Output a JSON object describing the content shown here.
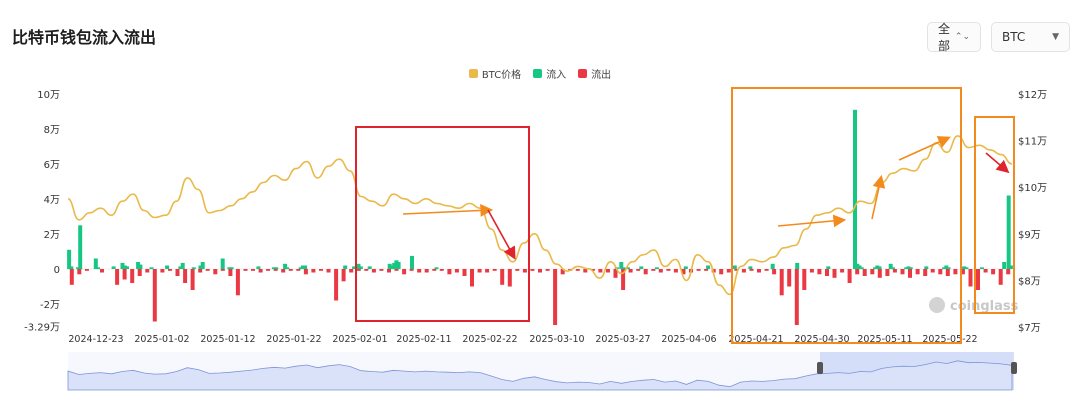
{
  "header": {
    "title": "比特币钱包流入流出",
    "range_select": "全部",
    "asset_select": "BTC"
  },
  "watermark": "coinglass",
  "colors": {
    "price": "#e9b949",
    "inflow": "#16c784",
    "outflow": "#ea3943",
    "box_red": "#e0242d",
    "box_orange": "#f38a1d",
    "arrow_orange": "#f38a1d",
    "arrow_red": "#e0242d",
    "navigator_fill": "#c8d3f5",
    "navigator_line": "#7d93d9"
  },
  "chart_data": {
    "type": "bar",
    "legend": [
      {
        "name": "BTC价格",
        "color": "#e9b949"
      },
      {
        "name": "流入",
        "color": "#16c784"
      },
      {
        "name": "流出",
        "color": "#ea3943"
      }
    ],
    "x_tick_labels": [
      "2024-12-23",
      "2025-01-02",
      "2025-01-12",
      "2025-01-22",
      "2025-02-01",
      "2025-02-11",
      "2025-02-22",
      "2025-03-10",
      "2025-03-27",
      "2025-04-06",
      "2025-04-21",
      "2025-04-30",
      "2025-05-11",
      "2025-05-22"
    ],
    "y_left_ticks": [
      "10万",
      "8万",
      "6万",
      "4万",
      "2万",
      "0",
      "-2万",
      "-3.29万"
    ],
    "y_left_values": [
      100000,
      80000,
      60000,
      40000,
      20000,
      0,
      -20000,
      -32900
    ],
    "y_right_ticks": [
      "$12万",
      "$11万",
      "$10万",
      "$9万",
      "$8万",
      "$7万"
    ],
    "y_right_values": [
      120000,
      110000,
      100000,
      90000,
      80000,
      70000
    ],
    "ylim_left": [
      -32900,
      100000
    ],
    "ylim_right": [
      70000,
      120000
    ],
    "series": [
      {
        "name": "流入",
        "type": "bar",
        "values": [
          11000,
          1500,
          0,
          0,
          1000,
          25000,
          0,
          0,
          0,
          0,
          0,
          0,
          6000,
          1000,
          0,
          0,
          0,
          0,
          0,
          0,
          1500,
          0,
          0,
          0,
          3500,
          2000,
          1500,
          0,
          0,
          0,
          0,
          4000,
          2500,
          0,
          0,
          0,
          0,
          1000,
          0,
          0,
          0,
          0,
          0,
          0,
          2000,
          0,
          0,
          0,
          0,
          0,
          1500,
          3500,
          0,
          0,
          0,
          0,
          1000,
          0,
          0,
          2000,
          4000,
          0,
          0,
          0,
          0,
          0,
          0,
          0,
          0,
          6000,
          0,
          0,
          1000,
          1000,
          0,
          0,
          0,
          0,
          0,
          0,
          0,
          0,
          0,
          0,
          0,
          1500,
          0,
          0,
          0,
          0,
          0,
          0,
          1000,
          1000,
          0,
          0,
          0,
          3000,
          1000,
          0,
          0,
          0,
          0,
          0,
          1000,
          2000,
          2000,
          0,
          0,
          0,
          0,
          0,
          0,
          0,
          0,
          0,
          0,
          0,
          0,
          0,
          0,
          0,
          0,
          0,
          2000,
          0,
          0,
          0,
          1500,
          0,
          3000,
          1500,
          0,
          0,
          0,
          1500,
          0,
          0,
          0,
          0,
          0,
          0,
          0,
          0,
          3000,
          2000,
          3500,
          5000,
          4000,
          0,
          0,
          0,
          0,
          0,
          7500,
          0,
          0,
          0,
          0,
          0,
          0,
          0,
          0,
          0,
          0,
          1000,
          0,
          0,
          0,
          0,
          0,
          0,
          0,
          0,
          0,
          0,
          0,
          0,
          0,
          0,
          0,
          0,
          0,
          0,
          0,
          0,
          0,
          0,
          0,
          0,
          0,
          0,
          0,
          0,
          0,
          0,
          0,
          0,
          0,
          0,
          0,
          0,
          0,
          0,
          0,
          0,
          0,
          0,
          0,
          0,
          0,
          0,
          0,
          0,
          0,
          0,
          0,
          0,
          0,
          0,
          0,
          0,
          0,
          0,
          0,
          0,
          0,
          0,
          0,
          0,
          0,
          0,
          0,
          0,
          0,
          0,
          0,
          0,
          0,
          0,
          0,
          0,
          0,
          0,
          0,
          0,
          1000,
          0,
          4000,
          1000,
          0,
          1000,
          0,
          0,
          0,
          0,
          0,
          1500,
          0,
          0,
          0,
          0,
          0,
          0,
          1000,
          0,
          0,
          0,
          0,
          0,
          0,
          0,
          0,
          0,
          0,
          0,
          0,
          1500,
          0,
          0,
          0,
          0,
          0,
          0,
          0,
          0,
          0,
          2000,
          0,
          0,
          0,
          0,
          0,
          0,
          0,
          0,
          0,
          0,
          0,
          2000,
          0,
          0,
          0,
          0,
          0,
          0,
          1500,
          0,
          0,
          0,
          0,
          0,
          0,
          0,
          0,
          0,
          3000,
          0,
          0,
          0,
          0,
          0,
          0,
          0,
          0,
          0,
          0,
          3500,
          0,
          0,
          0,
          0,
          0,
          0,
          0,
          0,
          0,
          0,
          0,
          0,
          0,
          1500,
          0,
          0,
          0,
          0,
          0,
          0,
          0,
          0,
          0,
          0,
          0,
          91000,
          3000,
          2000,
          1000,
          0,
          0,
          0,
          0,
          0,
          1000,
          2000,
          1500,
          0,
          0,
          0,
          0,
          3000,
          1000,
          0,
          0,
          0,
          0,
          0,
          1000,
          1500,
          1000,
          0,
          0,
          0,
          0,
          0,
          0,
          1500,
          0,
          0,
          0,
          0,
          0,
          0,
          0,
          1000,
          2000,
          1000,
          0,
          0,
          0,
          0,
          0,
          0,
          1500,
          1000,
          0,
          0,
          0,
          0,
          0,
          0,
          1000,
          0,
          0,
          0,
          0,
          0,
          0,
          0,
          0,
          0,
          4000,
          0,
          42000,
          2000
        ]
      },
      {
        "name": "流出",
        "type": "bar",
        "values": [
          -9000,
          -3000,
          -1000,
          0,
          -2000,
          0,
          -9000,
          -6000,
          -8000,
          -4000,
          -2000,
          -30000,
          -2000,
          -1000,
          -4000,
          -8000,
          -12000,
          -2000,
          -1000,
          -3000,
          -1000,
          -4000,
          -15000,
          -1000,
          -1000,
          -2000,
          -1000,
          -1000,
          -2000,
          -1000,
          -1000,
          -3000,
          -2000,
          -1000,
          -2000,
          -18000,
          -7000,
          -2000,
          -1000,
          -1000,
          -2000,
          -1000,
          -2000,
          -1000,
          -3000,
          -1000,
          -2000,
          -2000,
          -1000,
          -1000,
          -3000,
          -2000,
          -4000,
          -10000,
          -2000,
          -2000,
          -1000,
          -9000,
          -10000,
          -1000,
          -2000,
          -1000,
          -2000,
          -1000,
          -32000,
          -3000,
          -1000,
          -1000,
          -2000,
          -1000,
          -2000,
          -2000,
          -5000,
          -12000,
          -2000,
          -1000,
          -3000,
          -1000,
          -2000,
          -1000,
          -2000,
          -3000,
          -2000,
          -1000,
          -1000,
          -2000,
          -3000,
          -2000,
          -1000,
          -2000,
          -1000,
          -2000,
          -1000,
          -3000,
          -15000,
          -10000,
          -32000,
          -12000,
          -2000,
          -3000,
          -4000,
          -5000,
          -2000,
          -8000,
          -3000,
          -4000,
          -3000,
          -5000,
          -4000,
          -2000,
          -3000,
          -5000,
          -3000,
          -4000,
          -2000,
          -3000,
          -4000,
          -3000,
          -3000,
          -10000,
          -12000,
          -2000,
          -3000,
          -9000,
          -3000
        ]
      }
    ],
    "price_series": {
      "name": "BTC价格",
      "type": "line",
      "values": [
        97500,
        93000,
        94500,
        95500,
        94000,
        97000,
        98500,
        95000,
        93500,
        94000,
        97000,
        102000,
        99500,
        94500,
        95000,
        96000,
        97500,
        99000,
        101000,
        102500,
        101500,
        104000,
        105500,
        102000,
        104500,
        106000,
        103500,
        98000,
        97000,
        96000,
        98500,
        97500,
        96500,
        97500,
        96500,
        96000,
        95500,
        96500,
        95500,
        91000,
        86500,
        84000,
        88000,
        90000,
        86500,
        83500,
        82000,
        83000,
        82500,
        80500,
        84000,
        81500,
        84000,
        85500,
        86500,
        83000,
        84500,
        80000,
        85500,
        84000,
        79000,
        77000,
        83000,
        84500,
        84000,
        85000,
        87000,
        87500,
        91000,
        94000,
        94500,
        95500,
        94500,
        97000,
        96500,
        101000,
        103000,
        104000,
        103500,
        106000,
        109500,
        107500,
        111000,
        108500,
        109000,
        108000,
        107000,
        105000
      ]
    }
  }
}
